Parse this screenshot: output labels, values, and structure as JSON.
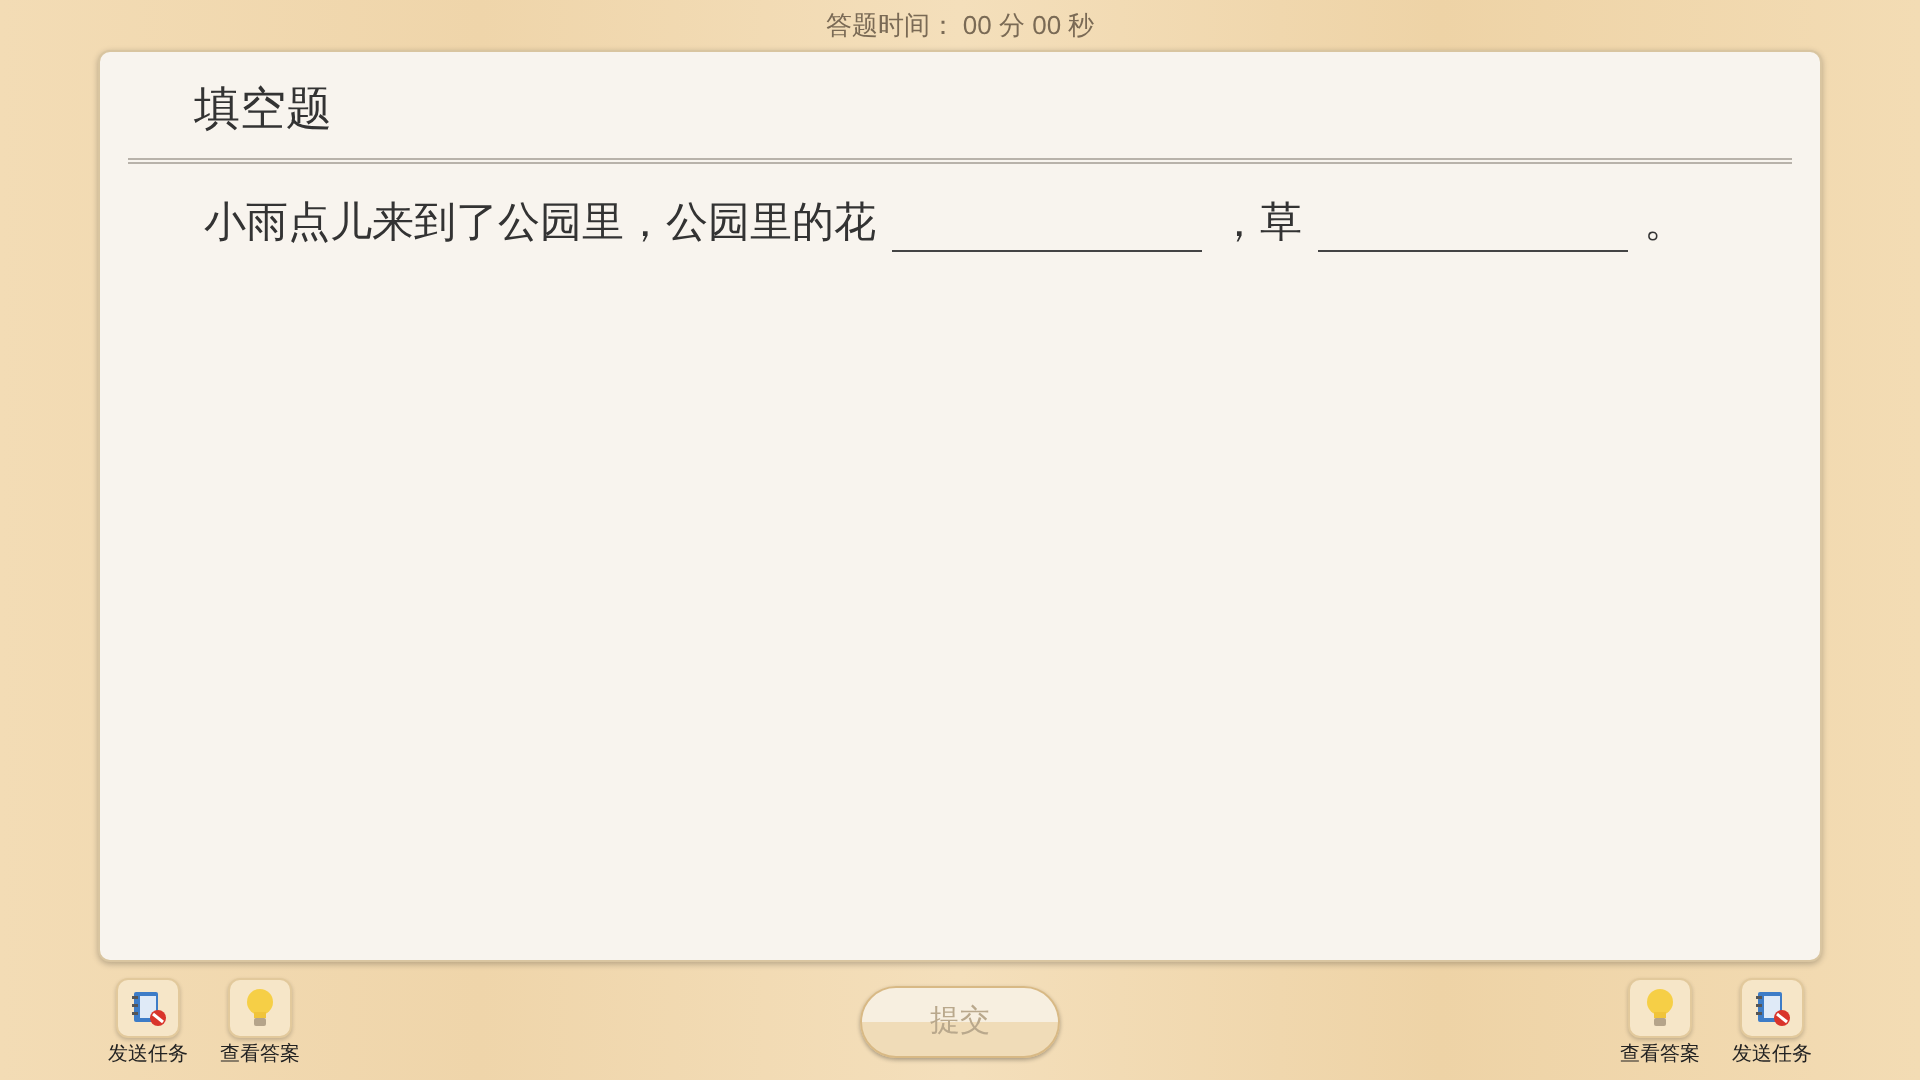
{
  "timer": "答题时间： 00 分 00 秒",
  "question": {
    "title": "填空题",
    "segments": [
      {
        "kind": "text",
        "text": "小雨点儿来到了公园里，公园里的花"
      },
      {
        "kind": "blank"
      },
      {
        "kind": "text",
        "text": "，草"
      },
      {
        "kind": "blank"
      },
      {
        "kind": "text",
        "text": "。"
      }
    ]
  },
  "left_tools": [
    {
      "kind": "send",
      "label": "发送任务"
    },
    {
      "kind": "answer",
      "label": "查看答案"
    }
  ],
  "submit": {
    "label": "提交",
    "disabled": true
  },
  "right_tools": [
    {
      "kind": "answer",
      "label": "查看答案"
    },
    {
      "kind": "send",
      "label": "发送任务"
    }
  ]
}
